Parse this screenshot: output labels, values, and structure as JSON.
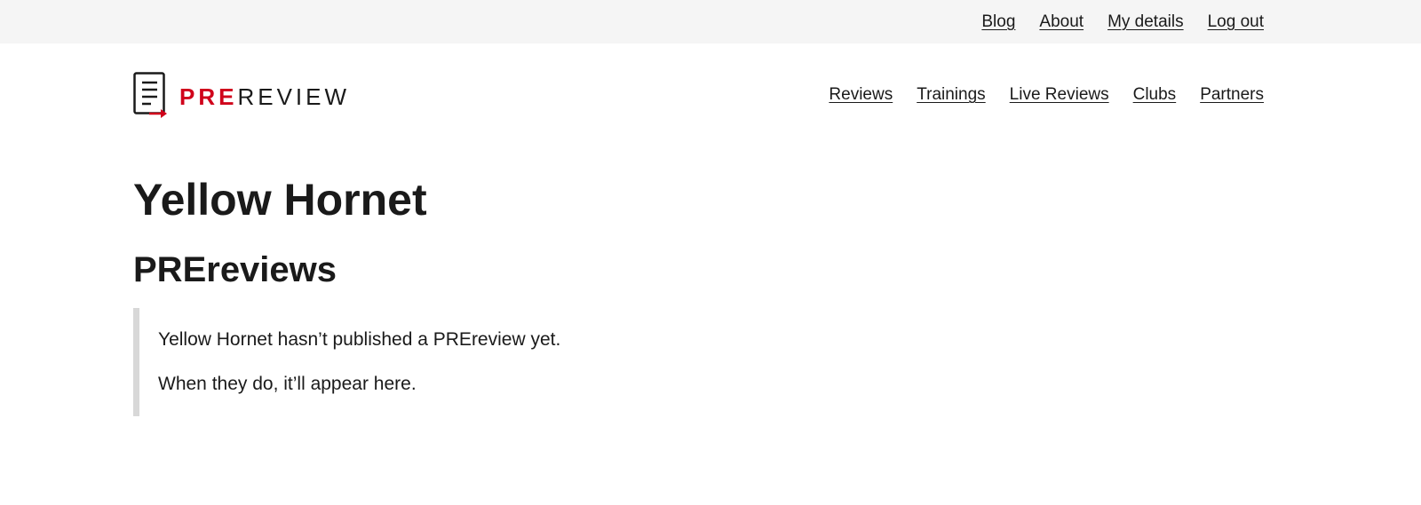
{
  "utility_nav": {
    "items": [
      {
        "label": "Blog"
      },
      {
        "label": "About"
      },
      {
        "label": "My details"
      },
      {
        "label": "Log out"
      }
    ]
  },
  "logo": {
    "pre": "PRE",
    "review": "REVIEW",
    "icon": "document-arrow-icon",
    "colors": {
      "accent": "#d0021b",
      "text": "#1a1a1a"
    }
  },
  "main_nav": {
    "items": [
      {
        "label": "Reviews"
      },
      {
        "label": "Trainings"
      },
      {
        "label": "Live Reviews"
      },
      {
        "label": "Clubs"
      },
      {
        "label": "Partners"
      }
    ]
  },
  "page": {
    "title": "Yellow Hornet",
    "section_title": "PREreviews",
    "empty_state": {
      "line1": "Yellow Hornet hasn’t published a PREreview yet.",
      "line2": "When they do, it’ll appear here."
    }
  }
}
